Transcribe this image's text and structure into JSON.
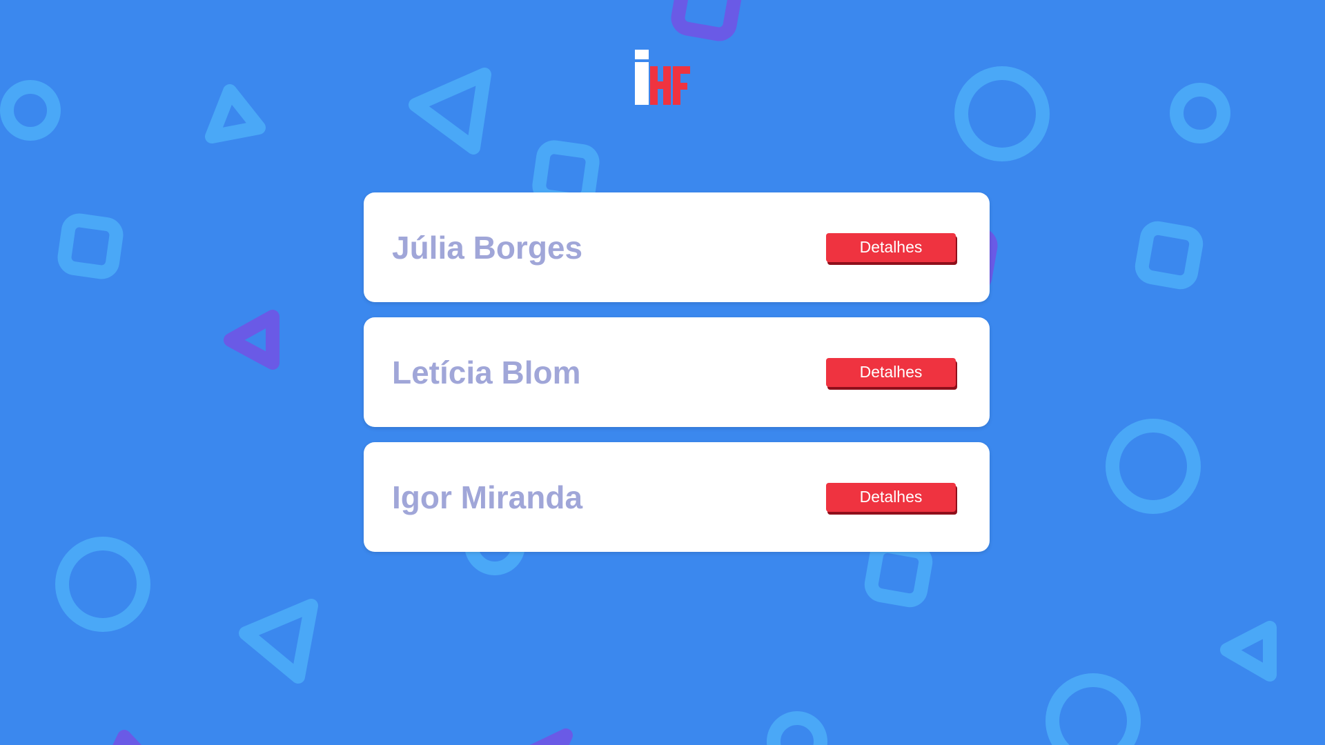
{
  "logo": {
    "text": "iHF",
    "colors": {
      "i": "#ffffff",
      "hf": "#ef3340"
    }
  },
  "cards": [
    {
      "name": "Júlia Borges",
      "button_label": "Detalhes"
    },
    {
      "name": "Letícia Blom",
      "button_label": "Detalhes"
    },
    {
      "name": "Igor Miranda",
      "button_label": "Detalhes"
    }
  ],
  "colors": {
    "background": "#3b88ee",
    "card": "#ffffff",
    "name_text": "#a0a6d8",
    "button": "#ef3340",
    "button_shadow": "#8e0f1b",
    "shape_light": "#4aa8f7",
    "shape_purple": "#6a5ae6"
  },
  "background_shapes": [
    "circle-ring",
    "triangle-outline",
    "square-outline"
  ]
}
